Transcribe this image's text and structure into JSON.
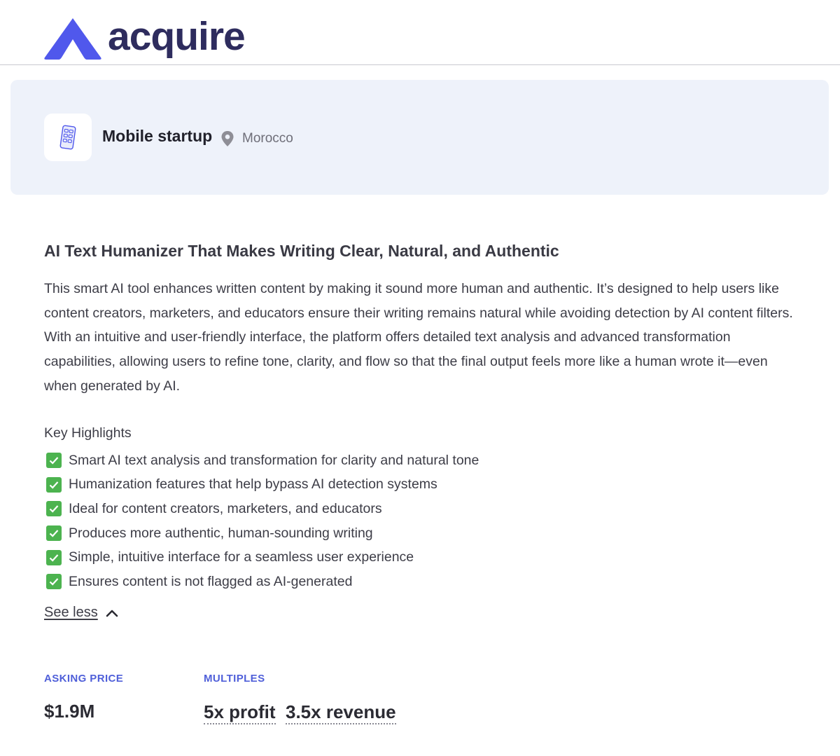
{
  "header": {
    "logo_text": "acquire",
    "logo_icon": "acquire-logo-mark",
    "brand_color": "#5058ec",
    "logo_text_color": "#2e2c5e"
  },
  "listing": {
    "icon": "mobile-phone-icon",
    "category": "Mobile startup",
    "location_icon": "map-pin-icon",
    "location": "Morocco",
    "title": "AI Text Humanizer That Makes Writing Clear, Natural, and Authentic",
    "description": "This smart AI tool enhances written content by making it sound more human and authentic. It’s designed to help users like content creators, marketers, and educators ensure their writing remains natural while avoiding detection by AI content filters. With an intuitive and user-friendly interface, the platform offers detailed text analysis and advanced transformation capabilities, allowing users to refine tone, clarity, and flow so that the final output feels more like a human wrote it—even when generated by AI.",
    "highlights_heading": "Key Highlights",
    "highlights": [
      "Smart AI text analysis and transformation for clarity and natural tone",
      "Humanization features that help bypass AI detection systems",
      "Ideal for content creators, marketers, and educators",
      "Produces more authentic, human-sounding writing",
      "Simple, intuitive interface for a seamless user experience",
      "Ensures content is not flagged as AI-generated"
    ],
    "see_less": "See less"
  },
  "metrics": {
    "asking_price_label": "ASKING PRICE",
    "asking_price": "$1.9M",
    "multiples_label": "MULTIPLES",
    "profit_multiple": "5x profit",
    "revenue_multiple": "3.5x revenue",
    "accent_color": "#4f5fd9"
  },
  "colors": {
    "card_background": "#eef2fa",
    "check_green": "#4cb34f"
  }
}
